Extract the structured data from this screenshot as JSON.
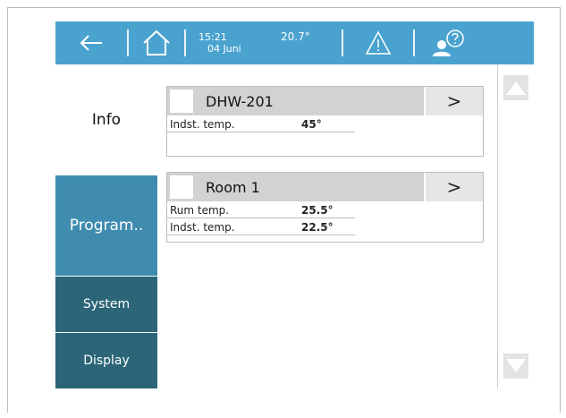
{
  "topbar": {
    "time": "15:21",
    "date": "04 Juni",
    "outdoor_temp": "20.7°",
    "icons": [
      "back-arrow-icon",
      "home-icon",
      "warning-icon",
      "user-help-icon"
    ],
    "color": "#4aa3cf"
  },
  "sidebar": {
    "info": "Info",
    "program": "Program..",
    "system": "System",
    "display": "Display"
  },
  "cards": [
    {
      "title": "DHW-201",
      "go": ">",
      "rows": [
        {
          "label": "Indst. temp.",
          "value": "45°"
        }
      ]
    },
    {
      "title": "Room 1",
      "go": ">",
      "rows": [
        {
          "label": "Rum temp.",
          "value": "25.5°"
        },
        {
          "label": "Indst. temp.",
          "value": "22.5°"
        }
      ]
    }
  ]
}
